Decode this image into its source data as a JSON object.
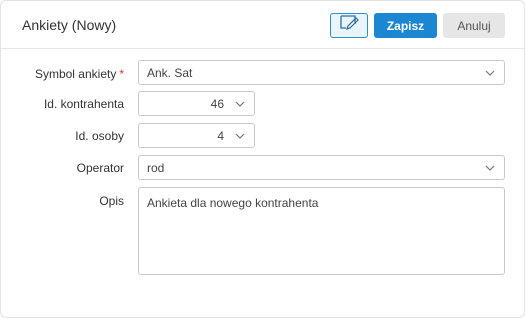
{
  "header": {
    "title": "Ankiety (Nowy)",
    "edit_icon": "edit-note-icon",
    "save_label": "Zapisz",
    "cancel_label": "Anuluj"
  },
  "form": {
    "symbol": {
      "label": "Symbol ankiety",
      "required_mark": "*",
      "value": "Ank. Sat"
    },
    "kontrahent": {
      "label": "Id. kontrahenta",
      "value": "46"
    },
    "osoba": {
      "label": "Id. osoby",
      "value": "4"
    },
    "operator": {
      "label": "Operator",
      "value": "rod"
    },
    "opis": {
      "label": "Opis",
      "value": "Ankieta dla nowego kontrahenta"
    }
  },
  "colors": {
    "primary": "#1b87d3",
    "required": "#d9342b"
  }
}
